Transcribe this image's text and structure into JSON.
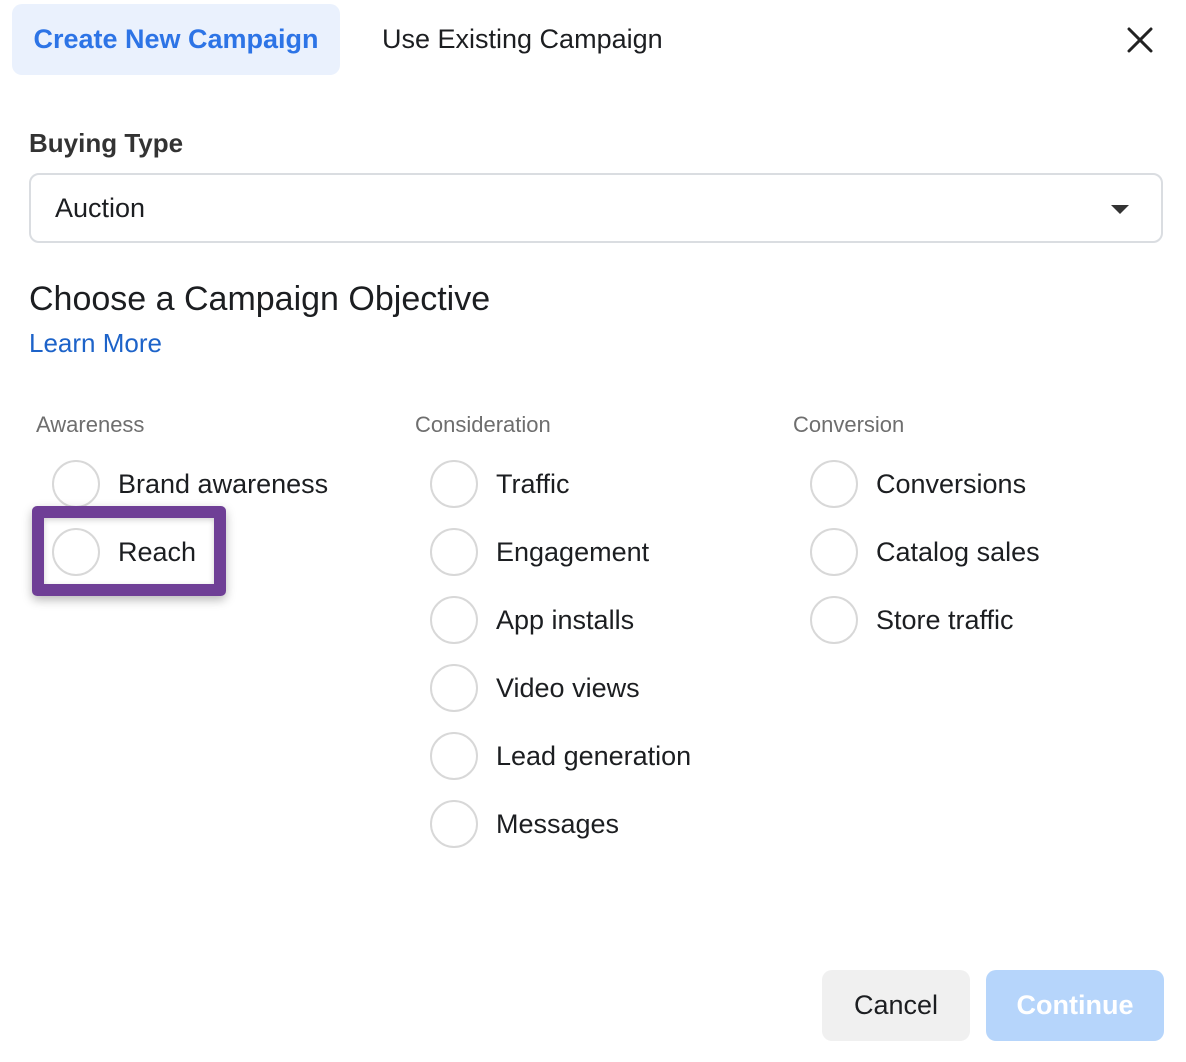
{
  "tabs": [
    {
      "label": "Create New Campaign",
      "active": true
    },
    {
      "label": "Use Existing Campaign",
      "active": false
    }
  ],
  "close_icon": "close-icon",
  "buying_type": {
    "label": "Buying Type",
    "selected": "Auction"
  },
  "objective": {
    "heading": "Choose a Campaign Objective",
    "learn_more": "Learn More",
    "columns": [
      {
        "title": "Awareness",
        "options": [
          "Brand awareness",
          "Reach"
        ]
      },
      {
        "title": "Consideration",
        "options": [
          "Traffic",
          "Engagement",
          "App installs",
          "Video views",
          "Lead generation",
          "Messages"
        ]
      },
      {
        "title": "Conversion",
        "options": [
          "Conversions",
          "Catalog sales",
          "Store traffic"
        ]
      }
    ],
    "highlighted_option": "Reach"
  },
  "footer": {
    "cancel_label": "Cancel",
    "continue_label": "Continue",
    "continue_enabled": false
  },
  "colors": {
    "accent": "#2d74e6",
    "active_tab_bg": "#eaf1fd",
    "link": "#1d63c9",
    "highlight_border": "#6f3f96",
    "continue_disabled_bg": "#b6d5fb"
  }
}
